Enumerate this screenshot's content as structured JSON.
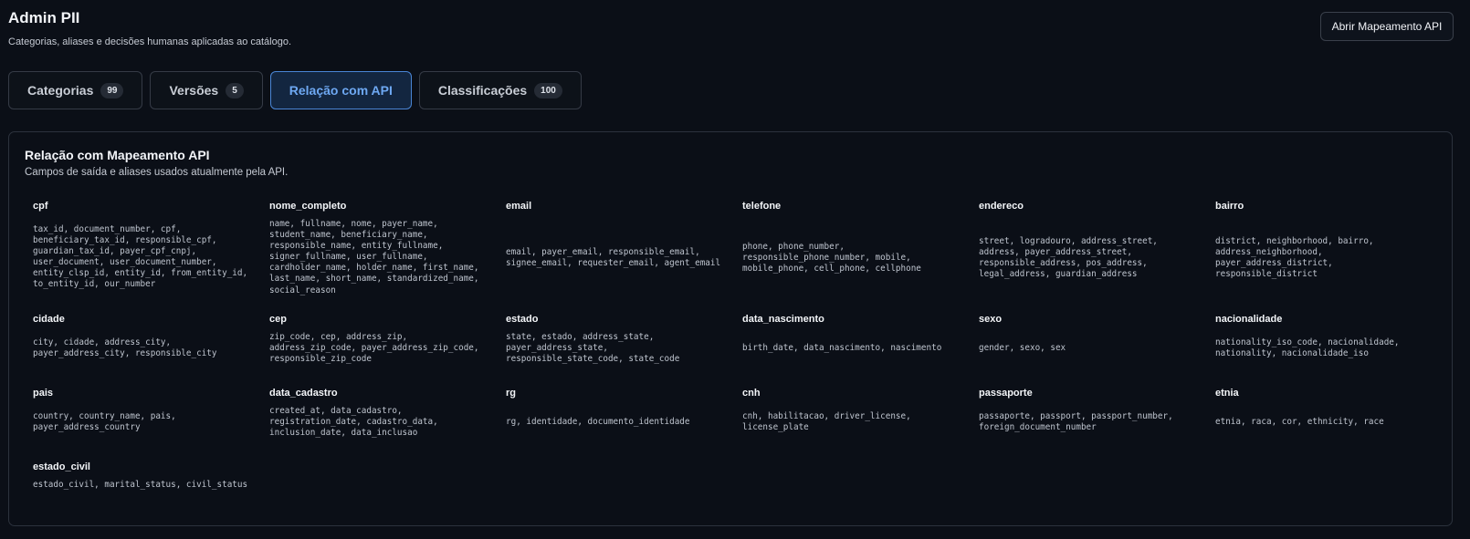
{
  "header": {
    "title": "Admin PII",
    "subtitle": "Categorias, aliases e decisões humanas aplicadas ao catálogo.",
    "action_label": "Abrir Mapeamento API"
  },
  "tabs": [
    {
      "label": "Categorias",
      "count": "99",
      "active": false
    },
    {
      "label": "Versões",
      "count": "5",
      "active": false
    },
    {
      "label": "Relação com API",
      "count": "",
      "active": true
    },
    {
      "label": "Classificações",
      "count": "100",
      "active": false
    }
  ],
  "panel": {
    "title": "Relação com Mapeamento API",
    "subtitle": "Campos de saída e aliases usados atualmente pela API."
  },
  "fields": [
    {
      "name": "cpf",
      "aliases": "tax_id, document_number, cpf, beneficiary_tax_id, responsible_cpf, guardian_tax_id, payer_cpf_cnpj, user_document, user_document_number, entity_clsp_id, entity_id, from_entity_id, to_entity_id, our_number"
    },
    {
      "name": "nome_completo",
      "aliases": "name, fullname, nome, payer_name, student_name, beneficiary_name, responsible_name, entity_fullname, signer_fullname, user_fullname, cardholder_name, holder_name, first_name, last_name, short_name, standardized_name, social_reason"
    },
    {
      "name": "email",
      "aliases": "email, payer_email, responsible_email, signee_email, requester_email, agent_email"
    },
    {
      "name": "telefone",
      "aliases": "phone, phone_number, responsible_phone_number, mobile, mobile_phone, cell_phone, cellphone"
    },
    {
      "name": "endereco",
      "aliases": "street, logradouro, address_street, address, payer_address_street, responsible_address, pos_address, legal_address, guardian_address"
    },
    {
      "name": "bairro",
      "aliases": "district, neighborhood, bairro, address_neighborhood, payer_address_district, responsible_district"
    },
    {
      "name": "cidade",
      "aliases": "city, cidade, address_city, payer_address_city, responsible_city"
    },
    {
      "name": "cep",
      "aliases": "zip_code, cep, address_zip, address_zip_code, payer_address_zip_code, responsible_zip_code"
    },
    {
      "name": "estado",
      "aliases": "state, estado, address_state, payer_address_state, responsible_state_code, state_code"
    },
    {
      "name": "data_nascimento",
      "aliases": "birth_date, data_nascimento, nascimento"
    },
    {
      "name": "sexo",
      "aliases": "gender, sexo, sex"
    },
    {
      "name": "nacionalidade",
      "aliases": "nationality_iso_code, nacionalidade, nationality, nacionalidade_iso"
    },
    {
      "name": "pais",
      "aliases": "country, country_name, pais, payer_address_country"
    },
    {
      "name": "data_cadastro",
      "aliases": "created_at, data_cadastro, registration_date, cadastro_data, inclusion_date, data_inclusao"
    },
    {
      "name": "rg",
      "aliases": "rg, identidade, documento_identidade"
    },
    {
      "name": "cnh",
      "aliases": "cnh, habilitacao, driver_license, license_plate"
    },
    {
      "name": "passaporte",
      "aliases": "passaporte, passport, passport_number, foreign_document_number"
    },
    {
      "name": "etnia",
      "aliases": "etnia, raca, cor, ethnicity, race"
    },
    {
      "name": "estado_civil",
      "aliases": "estado_civil, marital_status, civil_status"
    }
  ]
}
